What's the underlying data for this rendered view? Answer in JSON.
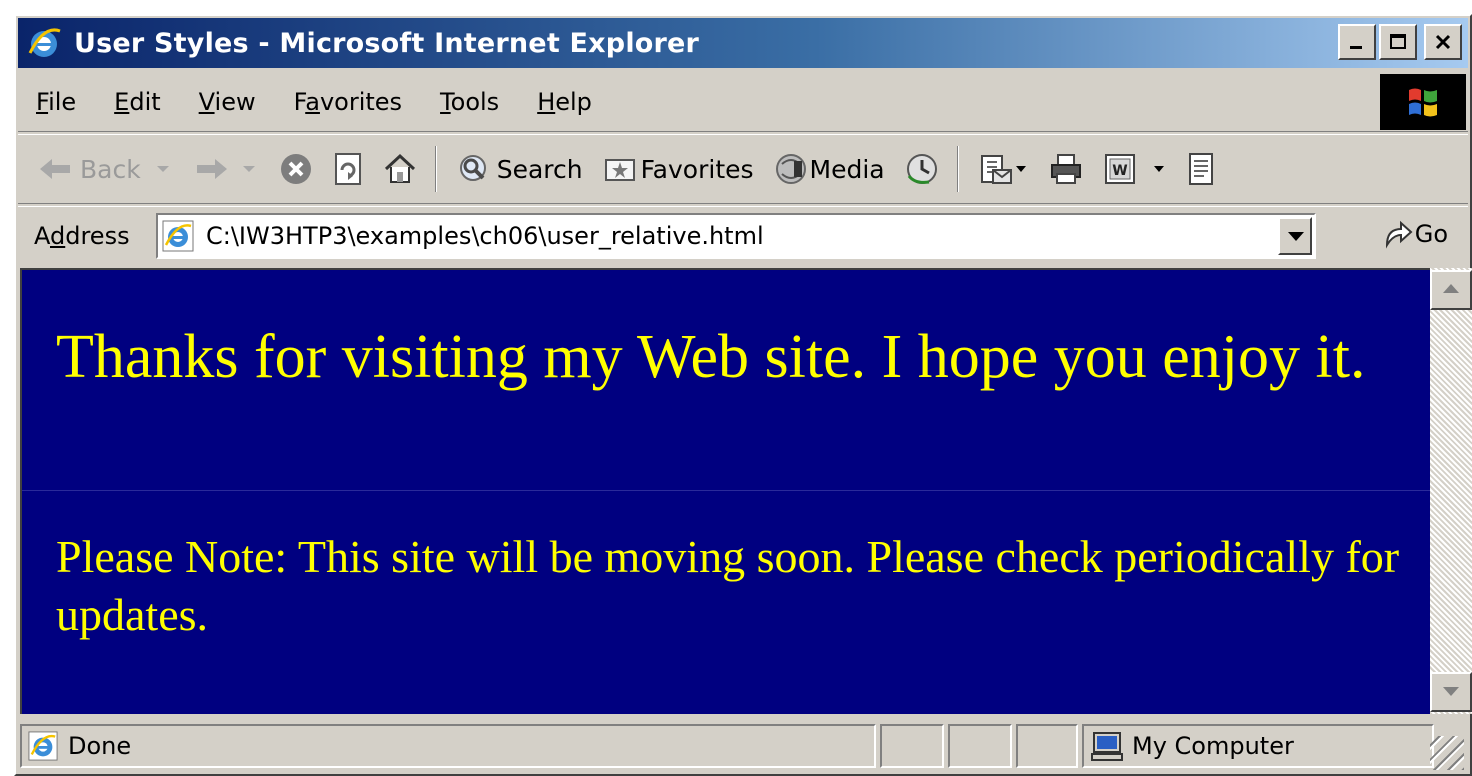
{
  "window": {
    "title": "User Styles - Microsoft Internet Explorer",
    "minimize": "_",
    "maximize": "□",
    "close": "×"
  },
  "menu": [
    {
      "pre": "",
      "key": "F",
      "post": "ile"
    },
    {
      "pre": "",
      "key": "E",
      "post": "dit"
    },
    {
      "pre": "",
      "key": "V",
      "post": "iew"
    },
    {
      "pre": "F",
      "key": "a",
      "post": "vorites"
    },
    {
      "pre": "",
      "key": "T",
      "post": "ools"
    },
    {
      "pre": "",
      "key": "H",
      "post": "elp"
    }
  ],
  "toolbar": {
    "back": "Back",
    "search": "Search",
    "favorites": "Favorites",
    "media": "Media"
  },
  "address": {
    "label_pre": "A",
    "label_key": "d",
    "label_post": "dress",
    "url": "C:\\IW3HTP3\\examples\\ch06\\user_relative.html",
    "go": "Go"
  },
  "content": {
    "paragraph1": "Thanks for visiting my Web site. I hope you enjoy it.",
    "paragraph2": "Please Note: This site will be moving soon. Please check periodically for updates.",
    "background": "#000080",
    "text_color": "#ffff00"
  },
  "status": {
    "text": "Done",
    "zone": "My Computer"
  }
}
